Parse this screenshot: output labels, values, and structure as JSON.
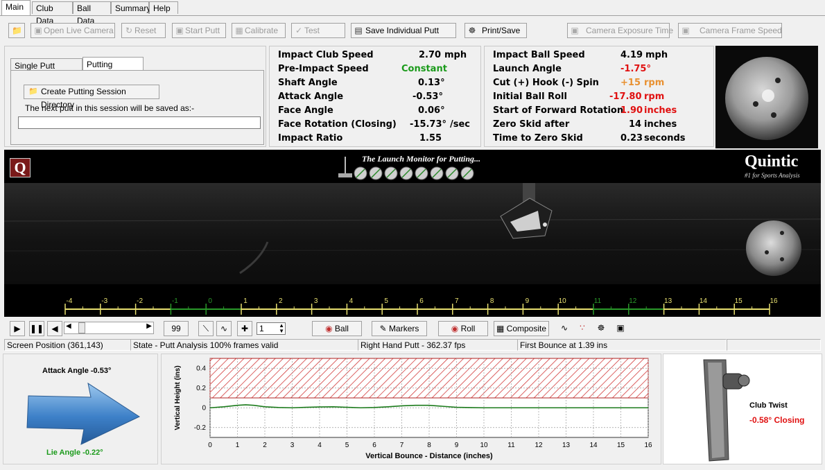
{
  "tabs": [
    "Main",
    "Club Data",
    "Ball Data",
    "Summary",
    "Help"
  ],
  "toolbar": {
    "open_live_camera": "Open Live Camera",
    "reset": "Reset",
    "start_putt": "Start Putt",
    "calibrate": "Calibrate",
    "test": "Test",
    "save_individual_putt": "Save Individual Putt",
    "print_save": "Print/Save",
    "camera_exposure_time": "Camera Exposure Time",
    "camera_frame_speed": "Camera Frame Speed"
  },
  "left_panel": {
    "tab_single": "Single Putt Analysis",
    "tab_session": "Putting Session",
    "create_dir_button": "Create Putting Session Directory",
    "next_putt_label": "The next putt in this session will be saved as:-",
    "next_putt_value": ""
  },
  "club_metrics": [
    {
      "label": "Impact Club Speed",
      "value": "2.70",
      "unit": "mph"
    },
    {
      "label": "Pre-Impact Speed",
      "value": "Constant",
      "unit": ""
    },
    {
      "label": "Shaft Angle",
      "value": "0.13°",
      "unit": ""
    },
    {
      "label": "Attack Angle",
      "value": "-0.53°",
      "unit": ""
    },
    {
      "label": "Face Angle",
      "value": "0.06°",
      "unit": ""
    },
    {
      "label": "Face Rotation (Closing)",
      "value": "-15.73°",
      "unit": "/sec"
    },
    {
      "label": "Impact Ratio",
      "value": "1.55",
      "unit": ""
    }
  ],
  "ball_metrics": [
    {
      "label": "Impact Ball Speed",
      "value": "4.19",
      "unit": "mph"
    },
    {
      "label": "Launch Angle",
      "value": "-1.75°",
      "unit": ""
    },
    {
      "label": "Cut (+) Hook (-) Spin",
      "value": "+15",
      "unit": "rpm"
    },
    {
      "label": "Initial Ball Roll",
      "value": "-17.80",
      "unit": "rpm"
    },
    {
      "label": "Start of Forward Rotation",
      "value": "1.90",
      "unit": "inches"
    },
    {
      "label": "Zero Skid after",
      "value": "14",
      "unit": "inches"
    },
    {
      "label": "Time to Zero Skid",
      "value": "0.23",
      "unit": "seconds"
    }
  ],
  "colors": {
    "red": "#e01010",
    "orange": "#e89030",
    "green": "#1a9a1a"
  },
  "video": {
    "tagline": "The Launch Monitor for Putting...",
    "brand": "Quintic",
    "brand_sub": "#1 for Sports Analysis",
    "logo_letter": "Q",
    "ruler_ticks": [
      "-4",
      "-3",
      "-2",
      "-1",
      "0",
      "1",
      "2",
      "3",
      "4",
      "5",
      "6",
      "7",
      "8",
      "9",
      "10",
      "11",
      "12",
      "13",
      "14",
      "15",
      "16"
    ]
  },
  "controls": {
    "frame_number": "99",
    "spin_value": "1",
    "ball": "Ball",
    "markers": "Markers",
    "roll": "Roll",
    "composite": "Composite"
  },
  "status": {
    "screen_position": "Screen Position (361,143)",
    "state": "State - Putt Analysis 100% frames valid",
    "hand": "Right Hand Putt  - 362.37 fps",
    "first_bounce": "First Bounce at 1.39 ins",
    "extra": ""
  },
  "bottom": {
    "attack_angle": "Attack Angle -0.53°",
    "lie_angle": "Lie Angle -0.22°",
    "club_twist_label": "Club Twist",
    "club_twist_value": "-0.58° Closing"
  },
  "chart_data": {
    "type": "line",
    "xlabel": "Vertical Bounce - Distance (inches)",
    "ylabel": "Vertical Height (ins)",
    "xlim": [
      0,
      16
    ],
    "ylim": [
      -0.3,
      0.5
    ],
    "xticks": [
      "0",
      "1",
      "2",
      "3",
      "4",
      "5",
      "6",
      "7",
      "8",
      "9",
      "10",
      "11",
      "12",
      "13",
      "14",
      "15",
      "16"
    ],
    "yticks": [
      "0.4",
      "0.2",
      "0",
      "-0.2"
    ],
    "hatched_region_y": [
      0.1,
      0.5
    ],
    "grid": true,
    "series": [
      {
        "x": [
          0,
          0.5,
          1,
          1.3,
          1.6,
          2,
          2.5,
          3,
          3.5,
          4,
          4.5,
          5,
          5.5,
          6,
          6.5,
          7,
          7.5,
          8,
          8.5,
          9,
          9.5,
          10,
          11,
          12,
          13,
          14,
          15,
          16
        ],
        "y": [
          0,
          0.01,
          0.025,
          0.03,
          0.025,
          0.01,
          0.003,
          0,
          0.005,
          0.008,
          0.01,
          0.005,
          0,
          0.003,
          0.01,
          0.02,
          0.025,
          0.025,
          0.015,
          0.005,
          0.002,
          0,
          0,
          0,
          0,
          0,
          0,
          0
        ],
        "color": "#1a7a1a"
      }
    ]
  }
}
